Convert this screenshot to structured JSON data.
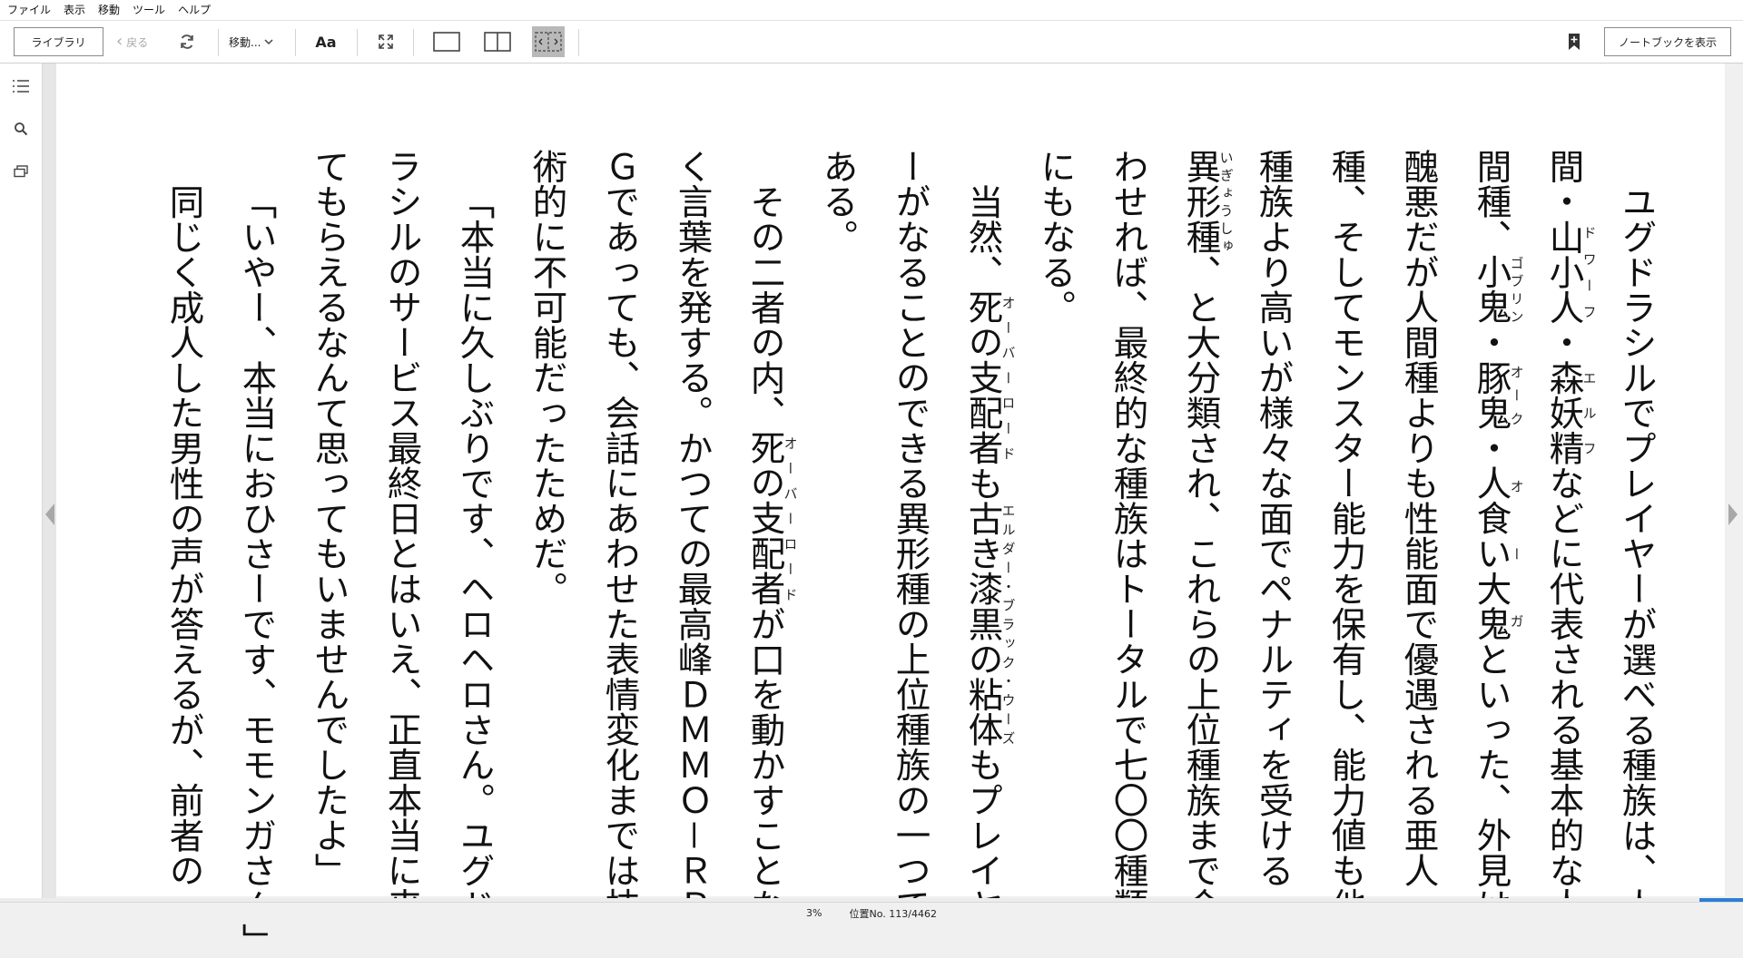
{
  "menu": [
    "ファイル",
    "表示",
    "移動",
    "ツール",
    "ヘルプ"
  ],
  "toolbar": {
    "library_label": "ライブラリ",
    "back_label": "戻る",
    "goto_label": "移動...",
    "font_label": "Aa",
    "notebook_label": "ノートブックを表示"
  },
  "icons": {
    "sync": "sync-icon",
    "fullscreen": "fullscreen-icon",
    "bookmark": "bookmark-icon",
    "toc": "toc-icon",
    "search": "search-icon",
    "flashcards": "flashcards-icon"
  },
  "colors": {
    "progress": "#2a7fd4",
    "active_layout_bg": "#b9b9b9"
  },
  "reader": {
    "paragraphs": [
      [
        {
          "t": "ユグドラシルでプレイヤーが選べる種族は、人間・"
        },
        {
          "t": "山小人",
          "r": "ドワーフ"
        },
        {
          "t": "・"
        },
        {
          "t": "森妖精",
          "r": "エルフ"
        },
        {
          "t": "などに代表される基本的な人間種、"
        },
        {
          "t": "小鬼",
          "r": "ゴブリン"
        },
        {
          "t": "・"
        },
        {
          "t": "豚鬼",
          "r": "オーク"
        },
        {
          "t": "・"
        },
        {
          "t": "人食い大鬼",
          "r": "オーガ"
        },
        {
          "t": "といった、外見は醜悪だが人間種よりも性能面で優遇される亜人種、そしてモンスター能力を保有し、能力値も他種族より高いが様々な面でペナルティを受ける"
        },
        {
          "t": "異形種",
          "r": "いぎょうしゅ"
        },
        {
          "t": "、と大分類され、これらの上位種族まで合わせれば、最終的な種族はトータルで七〇〇種類にもなる。"
        }
      ],
      [
        {
          "t": "当然、"
        },
        {
          "t": "死の支配者",
          "r": "オーバーロード"
        },
        {
          "t": "も"
        },
        {
          "t": "古き漆黒の粘体",
          "r": "エルダー・ブラック・ウーズ"
        },
        {
          "t": "もプレイヤーがなることのできる異形種の上位種族の一つである。"
        }
      ],
      [
        {
          "t": "その二者の内、"
        },
        {
          "t": "死の支配者",
          "r": "オーバーロード"
        },
        {
          "t": "が口を動かすことなく言葉を発する。かつての最高峰ＤＭＭＯ－ＲＰＧであっても、会話にあわせた表情変化までは技術的に不可能だったためだ。"
        }
      ],
      [
        {
          "t": "「本当に久しぶりです、ヘロヘロさん。ユグドラシルのサービス最終日とはいえ、正直本当に来てもらえるなんて思ってもいませんでしたよ」"
        }
      ],
      [
        {
          "t": "「いやー、本当におひさーです、モモンガさん」"
        }
      ],
      [
        {
          "t": "同じく成人した男性の声が答えるが、前者の"
        }
      ]
    ]
  },
  "status": {
    "percent": "3%",
    "location": "位置No. 113/4462",
    "progress_fraction": 0.03
  }
}
